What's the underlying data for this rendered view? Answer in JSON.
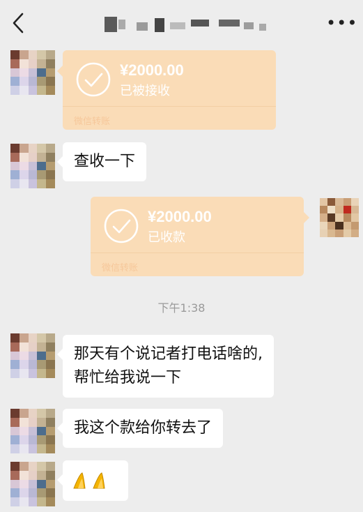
{
  "header": {
    "back_icon": "chevron-left-icon",
    "more_label": "•••"
  },
  "messages": {
    "transfer1": {
      "amount": "¥2000.00",
      "status": "已被接收",
      "brand": "微信转账"
    },
    "text1": "查收一下",
    "transfer2": {
      "amount": "¥2000.00",
      "status": "已收款",
      "brand": "微信转账"
    },
    "time": "下午1:38",
    "text2_line1": "那天有个说记者打电话啥的,",
    "text2_line2": "帮忙给我说一下",
    "text3": "我这个款给你转去了",
    "emoji_icon": "pray-hands-emoji-icon"
  },
  "colors": {
    "background": "#ededed",
    "bubble": "#ffffff",
    "transfer": "#fadcb7"
  }
}
